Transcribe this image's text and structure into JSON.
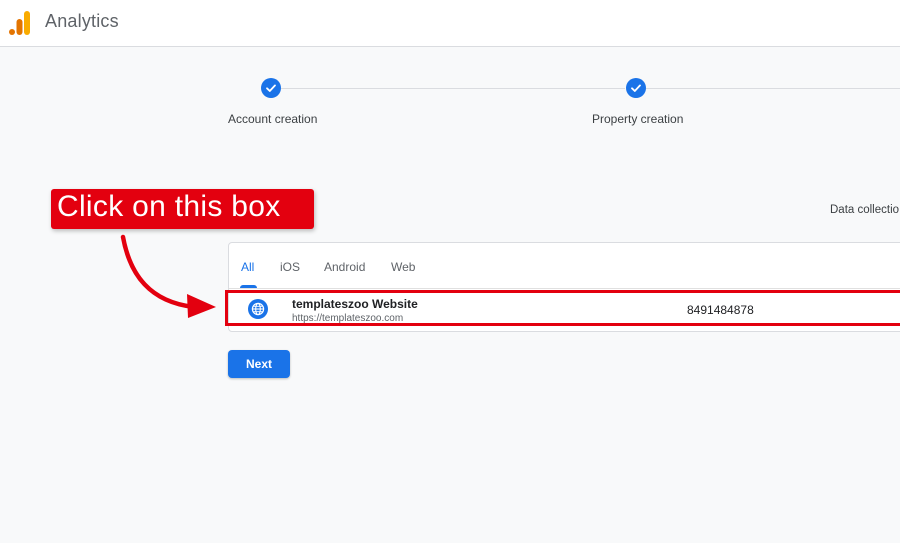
{
  "header": {
    "app_title": "Analytics",
    "logo_icon": "analytics-logo-icon"
  },
  "stepper": {
    "steps": [
      {
        "label": "Account creation",
        "status": "completed",
        "icon": "check-icon"
      },
      {
        "label": "Property creation",
        "status": "completed",
        "icon": "check-icon"
      }
    ]
  },
  "data_collection": {
    "heading_partial": "Data collectio"
  },
  "platform_tabs": {
    "tabs": [
      {
        "label": "All",
        "active": true
      },
      {
        "label": "iOS",
        "active": false
      },
      {
        "label": "Android",
        "active": false
      },
      {
        "label": "Web",
        "active": false
      }
    ]
  },
  "data_stream": {
    "icon": "globe-icon",
    "name": "templateszoo Website",
    "url": "https://templateszoo.com",
    "stream_id": "8491484878"
  },
  "actions": {
    "next_label": "Next"
  },
  "annotation": {
    "callout_text": "Click on this box",
    "arrow_icon": "curved-arrow-icon"
  },
  "colors": {
    "accent": "#1a73e8",
    "annotation_red": "#e3000f",
    "background": "#f8f9fa",
    "logo_orange": "#f9ab00",
    "logo_dark_orange": "#e37400"
  }
}
